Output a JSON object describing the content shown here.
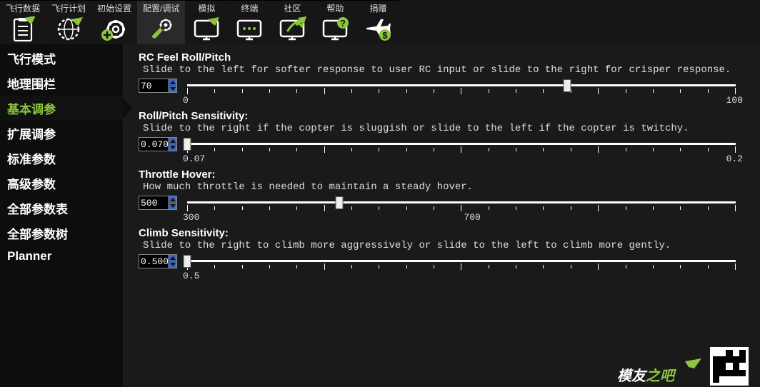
{
  "tabs": [
    {
      "label": "飞行数据",
      "icon": "clipboard-plane"
    },
    {
      "label": "飞行计划",
      "icon": "globe-plane"
    },
    {
      "label": "初始设置",
      "icon": "gear-plus"
    },
    {
      "label": "配置/调试",
      "icon": "wrench-gear",
      "selected": true
    },
    {
      "label": "模拟",
      "icon": "monitor-plane"
    },
    {
      "label": "终端",
      "icon": "monitor-dots"
    },
    {
      "label": "社区",
      "icon": "monitor-arrow"
    },
    {
      "label": "帮助",
      "icon": "monitor-help"
    },
    {
      "label": "捐赠",
      "icon": "plane-dollar"
    }
  ],
  "sidebar": [
    {
      "label": "飞行模式"
    },
    {
      "label": "地理围栏"
    },
    {
      "label": "基本调参",
      "selected": true
    },
    {
      "label": "扩展调参"
    },
    {
      "label": "标准参数"
    },
    {
      "label": "高级参数"
    },
    {
      "label": "全部参数表"
    },
    {
      "label": "全部参数树"
    },
    {
      "label": "Planner"
    }
  ],
  "params": [
    {
      "title": "RC Feel Roll/Pitch",
      "desc": "Slide to the left for softer response to user RC input or slide to the right for crisper response.",
      "value": "70",
      "pos": 70,
      "scale_left": "0",
      "scale_right": "100",
      "narrow": false
    },
    {
      "title": "Roll/Pitch Sensitivity:",
      "desc": "Slide to the right if the copter is sluggish or slide to the left if the copter is twitchy.",
      "value": "0.070",
      "pos": 0,
      "scale_left": "0.07",
      "scale_right": "0.2",
      "narrow": false
    },
    {
      "title": "Throttle Hover:",
      "desc": "How much throttle is needed to maintain a steady hover.",
      "value": "500",
      "pos": 28,
      "scale_left": "300",
      "scale_right": "700",
      "narrow": true
    },
    {
      "title": "Climb Sensitivity:",
      "desc": "Slide to the right to climb more aggressively or slide to the left to climb more gently.",
      "value": "0.500",
      "pos": 0,
      "scale_left": "0.5",
      "scale_right": "",
      "narrow": false
    }
  ],
  "watermark": {
    "logo_text_1": "模友",
    "logo_text_2": "之吧"
  }
}
